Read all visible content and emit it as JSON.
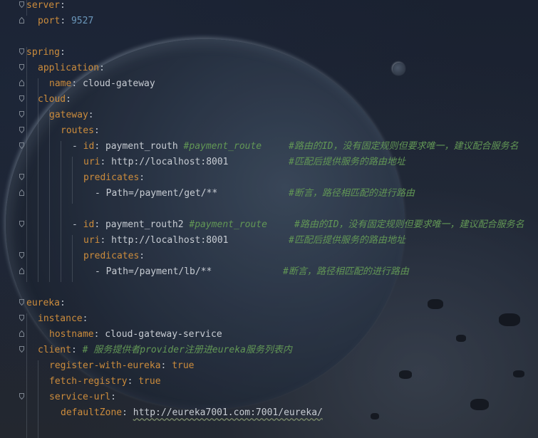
{
  "yaml": {
    "server": {
      "key": "server",
      "port_key": "port",
      "port_value": "9527"
    },
    "spring": {
      "key": "spring",
      "application_key": "application",
      "name_key": "name",
      "name_value": "cloud-gateway",
      "cloud_key": "cloud",
      "gateway_key": "gateway",
      "routes_key": "routes",
      "routes": [
        {
          "id_key": "id",
          "id_value": "payment_routh",
          "id_ref": "#payment_route",
          "id_comment": "#路由的ID，没有固定规则但要求唯一，建议配合服务名",
          "uri_key": "uri",
          "uri_value": "http://localhost:8001",
          "uri_comment": "#匹配后提供服务的路由地址",
          "predicates_key": "predicates",
          "predicate": "- Path=/payment/get/**",
          "predicate_comment": "#断言，路径相匹配的进行路由"
        },
        {
          "id_key": "id",
          "id_value": "payment_routh2",
          "id_ref": "#payment_route",
          "id_comment": "#路由的ID，没有固定规则但要求唯一，建议配合服务名",
          "uri_key": "uri",
          "uri_value": "http://localhost:8001",
          "uri_comment": "#匹配后提供服务的路由地址",
          "predicates_key": "predicates",
          "predicate": "- Path=/payment/lb/**",
          "predicate_comment": "#断言，路径相匹配的进行路由"
        }
      ]
    },
    "eureka": {
      "key": "eureka",
      "instance_key": "instance",
      "hostname_key": "hostname",
      "hostname_value": "cloud-gateway-service",
      "client_key": "client",
      "client_comment": "# 服务提供者provider注册进eureka服务列表内",
      "register_key": "register-with-eureka",
      "register_value": "true",
      "fetch_key": "fetch-registry",
      "fetch_value": "true",
      "service_url_key": "service-url",
      "default_zone_key": "defaultZone",
      "default_zone_value": "http://eureka7001.com:7001/eureka/"
    }
  }
}
